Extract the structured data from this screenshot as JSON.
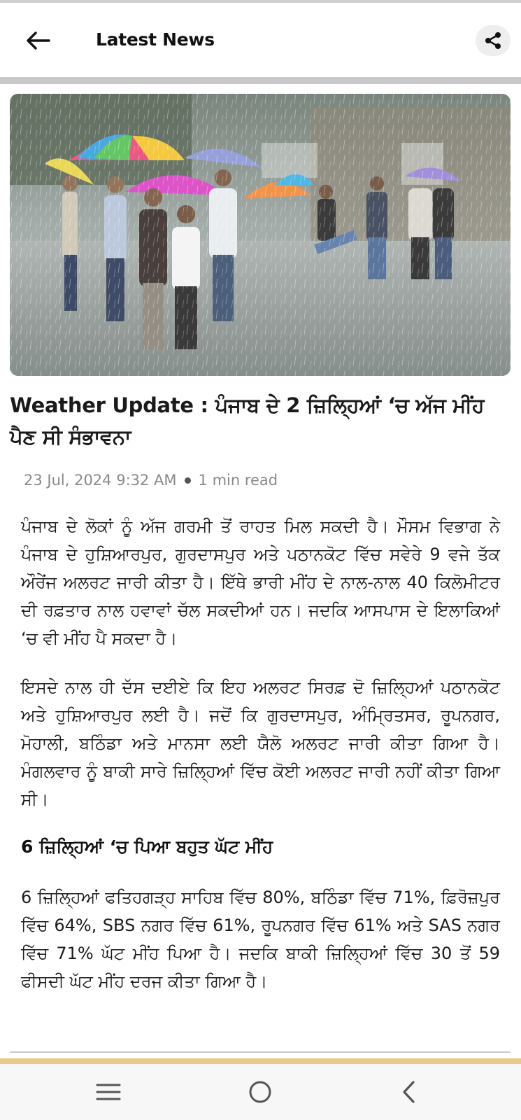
{
  "app_bar": {
    "title": "Latest News",
    "back_icon": "arrow-left-icon",
    "share_icon": "share-icon"
  },
  "article": {
    "image_alt": "People walking with colorful umbrellas in heavy rain",
    "headline": "Weather Update : ਪੰਜਾਬ ਦੇ 2 ਜ਼ਿਲ੍ਹਿਆਂ ‘ਚ ਅੱਜ ਮੀਂਹ ਪੈਣ ਸੀ ਸੰਭਾਵਨਾ",
    "date": "23 Jul, 2024 9:32 AM",
    "read_time": "1 min read",
    "paragraphs": [
      "ਪੰਜਾਬ ਦੇ ਲੋਕਾਂ ਨੂੰ ਅੱਜ ਗਰਮੀ ਤੋਂ ਰਾਹਤ ਮਿਲ ਸਕਦੀ ਹੈ। ਮੌਸਮ ਵਿਭਾਗ ਨੇ ਪੰਜਾਬ ਦੇ ਹੁਸ਼ਿਆਰਪੁਰ, ਗੁਰਦਾਸਪੁਰ ਅਤੇ ਪਠਾਨਕੋਟ ਵਿੱਚ ਸਵੇਰੇ 9 ਵਜੇ ਤੱਕ ਔਰੇਂਜ ਅਲਰਟ ਜਾਰੀ ਕੀਤਾ ਹੈ। ਇੱਥੇ ਭਾਰੀ ਮੀਂਹ ਦੇ ਨਾਲ-ਨਾਲ 40 ਕਿਲੋਮੀਟਰ ਦੀ ਰਫ਼ਤਾਰ ਨਾਲ ਹਵਾਵਾਂ ਚੱਲ ਸਕਦੀਆਂ ਹਨ। ਜਦਕਿ ਆਸਪਾਸ ਦੇ ਇਲਾਕਿਆਂ ‘ਚ ਵੀ ਮੀਂਹ ਪੈ ਸਕਦਾ ਹੈ।",
      "ਇਸਦੇ ਨਾਲ ਹੀ ਦੱਸ ਦਈਏ ਕਿ ਇਹ ਅਲਰਟ ਸਿਰਫ਼ ਦੋ ਜ਼ਿਲ੍ਹਿਆਂ ਪਠਾਨਕੋਟ ਅਤੇ ਹੁਸ਼ਿਆਰਪੁਰ ਲਈ ਹੈ। ਜਦੋਂ ਕਿ ਗੁਰਦਾਸਪੁਰ, ਅੰਮ੍ਰਿਤਸਰ, ਰੂਪਨਗਰ, ਮੋਹਾਲੀ, ਬਠਿੰਡਾ ਅਤੇ ਮਾਨਸਾ ਲਈ ਯੈਲੋ ਅਲਰਟ ਜਾਰੀ ਕੀਤਾ ਗਿਆ ਹੈ। ਮੰਗਲਵਾਰ ਨੂੰ ਬਾਕੀ ਸਾਰੇ ਜ਼ਿਲ੍ਹਿਆਂ ਵਿੱਚ ਕੋਈ ਅਲਰਟ ਜਾਰੀ ਨਹੀਂ ਕੀਤਾ ਗਿਆ ਸੀ।"
    ],
    "subheading": "6 ਜ਼ਿਲ੍ਹਿਆਂ ‘ਚ ਪਿਆ ਬਹੁਤ ਘੱਟ ਮੀਂਹ",
    "paragraph3": "6 ਜ਼ਿਲ੍ਹਿਆਂ ਫਤਿਹਗੜ੍ਹ ਸਾਹਿਬ ਵਿੱਚ 80%, ਬਠਿੰਡਾ ਵਿੱਚ 71%, ਫ਼ਿਰੋਜ਼ਪੁਰ ਵਿੱਚ 64%, SBS ਨਗਰ ਵਿੱਚ 61%, ਰੂਪਨਗਰ ਵਿੱਚ 61% ਅਤੇ SAS ਨਗਰ ਵਿੱਚ 71% ਘੱਟ ਮੀਂਹ ਪਿਆ ਹੈ। ਜਦਕਿ ਬਾਕੀ ਜ਼ਿਲ੍ਹਿਆਂ ਵਿੱਚ 30 ਤੋਂ 59 ਫੀਸਦੀ ਘੱਟ ਮੀਂਹ ਦਰਜ ਕੀਤਾ ਗਿਆ ਹੈ।"
  },
  "system_nav": {
    "recents_icon": "menu-lines-icon",
    "home_icon": "home-circle-icon",
    "back_icon": "chevron-left-icon"
  },
  "colors": {
    "divider": "#c8c8c8",
    "accent_strip": "#e8c98a",
    "meta_text": "#8a8a8a"
  }
}
